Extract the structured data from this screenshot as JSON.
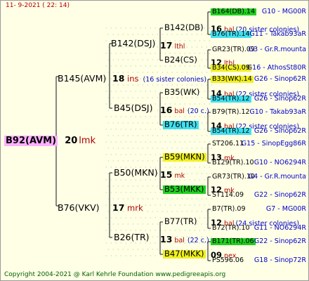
{
  "header": {
    "date": "11-  9-2021 (  22:  14)"
  },
  "footer": {
    "copyright": "Copyright 2004-2021 @ Karl Kehrle Foundation    www.pedigreeapis.org"
  },
  "root": {
    "id": "B92(AVM)",
    "count": "20",
    "name": "lmk",
    "bg": "#ffb0ff"
  },
  "gen1": [
    {
      "key": "g1a",
      "id": "B145(AVM)",
      "count": "18",
      "name": "ins",
      "note": "(16 sister colonies)"
    },
    {
      "key": "g1b",
      "id": "B76(VKV)",
      "count": "17",
      "name": "mrk",
      "note": ""
    }
  ],
  "gen2": [
    {
      "key": "g2a",
      "id": "B142(DSJ)",
      "count": "17",
      "name": "lthl",
      "note": ""
    },
    {
      "key": "g2b",
      "id": "B45(DSJ)",
      "count": "16",
      "name": "bal",
      "note": "(20 c.)"
    },
    {
      "key": "g2c",
      "id": "B50(MKN)",
      "count": "15",
      "name": "mk",
      "note": ""
    },
    {
      "key": "g2d",
      "id": "B26(TR)",
      "count": "13",
      "name": "bal",
      "note": "(22 c.)"
    }
  ],
  "gen3": [
    {
      "key": "g3a",
      "id": "B142(DB)",
      "bg": "",
      "count": "",
      "name": "",
      "note": ""
    },
    {
      "key": "g3b",
      "id": "B24(CS)",
      "bg": "",
      "count": "",
      "name": "",
      "note": ""
    },
    {
      "key": "g3c",
      "id": "B35(WK)",
      "bg": "",
      "count": "",
      "name": "",
      "note": ""
    },
    {
      "key": "g3d",
      "id": "B76(TR)",
      "bg": "#40e0f0",
      "count": "",
      "name": "",
      "note": ""
    },
    {
      "key": "g3e",
      "id": "B59(MKN)",
      "bg": "#f0f020",
      "count": "",
      "name": "",
      "note": ""
    },
    {
      "key": "g3f",
      "id": "B53(MKK)",
      "bg": "#20d020",
      "count": "",
      "name": "",
      "note": ""
    },
    {
      "key": "g3g",
      "id": "B77(TR)",
      "bg": "",
      "count": "",
      "name": "",
      "note": ""
    },
    {
      "key": "g3h",
      "id": "B47(MKK)",
      "bg": "#f0f020",
      "count": "",
      "name": "",
      "note": ""
    }
  ],
  "gen4": [
    {
      "key": "a1",
      "id": "B164(DB).14",
      "bg": "#20d020",
      "ref": "G10 - MG00R"
    },
    {
      "key": "a2",
      "mid": true,
      "count": "16",
      "name": "bal",
      "note": "(20 sister colonies)"
    },
    {
      "key": "a3",
      "id": "B76(TR).14",
      "bg": "#40e0f0",
      "ref": "G11 - Takab93aR"
    },
    {
      "key": "b1",
      "id": "GR23(TR).09",
      "bg": "",
      "ref": "G3 - Gr.R.mounta"
    },
    {
      "key": "b2",
      "mid": true,
      "count": "12",
      "name": "lthl",
      "note": ""
    },
    {
      "key": "b3",
      "id": "B34(CS).09",
      "bg": "#f0f020",
      "ref": "G16 - AthosSt80R"
    },
    {
      "key": "c1",
      "id": "B33(WK).14",
      "bg": "#f0f020",
      "ref": "G26 - Sinop62R"
    },
    {
      "key": "c2",
      "mid": true,
      "count": "14",
      "name": "bal",
      "note": "(22 sister colonies)"
    },
    {
      "key": "c3",
      "id": "B54(TR).12",
      "bg": "#40e0f0",
      "ref": "G26 - Sinop62R"
    },
    {
      "key": "d1",
      "id": "B79(TR).12",
      "bg": "",
      "ref": "G10 - Takab93aR"
    },
    {
      "key": "d2",
      "mid": true,
      "count": "14",
      "name": "bal",
      "note": "(22 sister colonies)"
    },
    {
      "key": "d3",
      "id": "B54(TR).12",
      "bg": "#40e0f0",
      "ref": "G26 - Sinop62R"
    },
    {
      "key": "e1",
      "id": "ST206.11",
      "bg": "",
      "ref": "G15 - SinopEgg86R"
    },
    {
      "key": "e2",
      "mid": true,
      "count": "13",
      "name": "mk",
      "note": ""
    },
    {
      "key": "e3",
      "id": "B129(TR).10",
      "bg": "",
      "ref": "G10 - NO6294R"
    },
    {
      "key": "f1",
      "id": "GR73(TR).10",
      "bg": "",
      "ref": "G4 - Gr.R.mounta"
    },
    {
      "key": "f2",
      "mid": true,
      "count": "12",
      "name": "mk",
      "note": ""
    },
    {
      "key": "f3",
      "id": "ST114.09",
      "bg": "",
      "ref": "G22 - Sinop62R"
    },
    {
      "key": "g1",
      "id": "B7(TR).09",
      "bg": "",
      "ref": "G7 - MG00R"
    },
    {
      "key": "g2",
      "mid": true,
      "count": "12",
      "name": "bal",
      "note": "(24 sister colonies)"
    },
    {
      "key": "g3",
      "id": "B72(TR).10",
      "bg": "",
      "ref": "G11 - NO6294R"
    },
    {
      "key": "h1",
      "id": "B171(TR).06",
      "bg": "#20d020",
      "ref": "G22 - Sinop62R"
    },
    {
      "key": "h2",
      "mid": true,
      "count": "09",
      "name": "nex",
      "note": ""
    },
    {
      "key": "h3",
      "id": "PS596.06",
      "bg": "",
      "ref": "G18 - Sinop72R"
    }
  ]
}
